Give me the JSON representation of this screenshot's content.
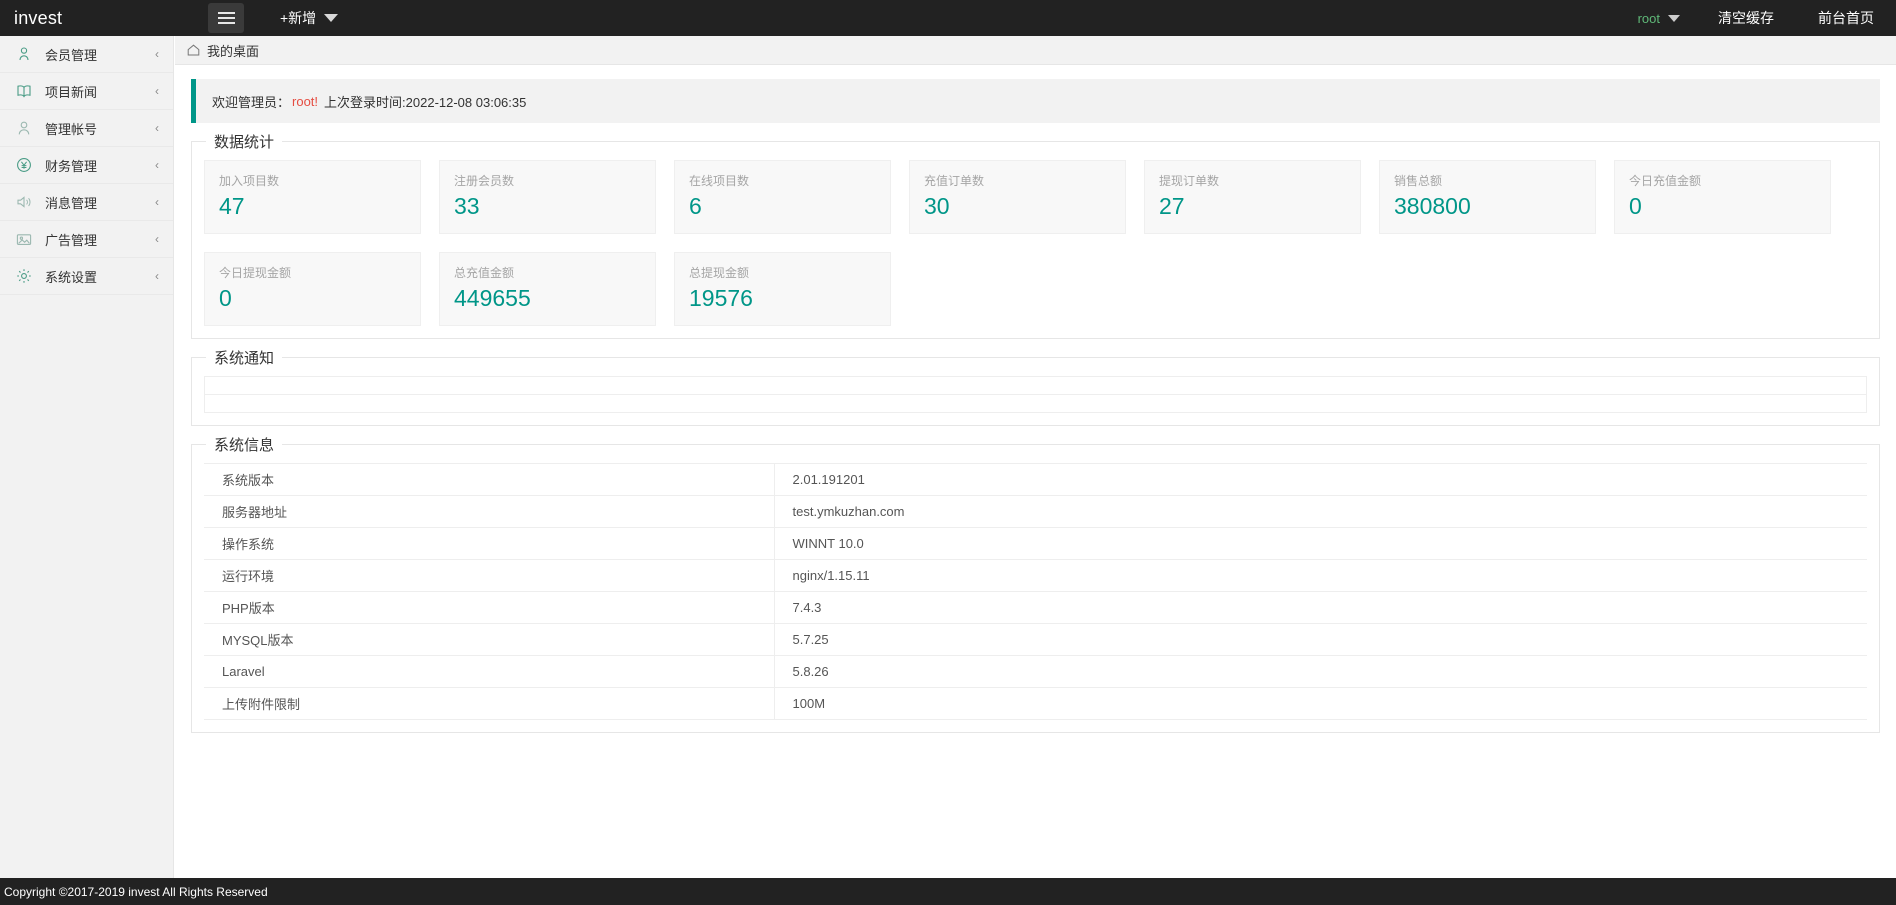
{
  "header": {
    "brand": "invest",
    "menu_toggle_icon": "hamburger-icon",
    "add_label": "+新增",
    "add_caret_icon": "chevron-down-icon",
    "user_name": "root",
    "user_caret_icon": "chevron-down-icon",
    "clear_cache_label": "清空缓存",
    "front_home_label": "前台首页",
    "accent_color": "#5fb878",
    "background_color": "#222222"
  },
  "sidebar": {
    "items": [
      {
        "label": "会员管理",
        "icon": "user-icon",
        "arrow_icon": "chevron-left-icon"
      },
      {
        "label": "项目新闻",
        "icon": "book-icon",
        "arrow_icon": "chevron-left-icon"
      },
      {
        "label": "管理帐号",
        "icon": "user-circle-icon",
        "arrow_icon": "chevron-left-icon"
      },
      {
        "label": "财务管理",
        "icon": "yen-circle-icon",
        "arrow_icon": "chevron-left-icon"
      },
      {
        "label": "消息管理",
        "icon": "speaker-icon",
        "arrow_icon": "chevron-left-icon"
      },
      {
        "label": "广告管理",
        "icon": "image-icon",
        "arrow_icon": "chevron-left-icon"
      },
      {
        "label": "系统设置",
        "icon": "gear-icon",
        "arrow_icon": "chevron-left-icon"
      }
    ]
  },
  "breadcrumb": {
    "home_icon": "home-icon",
    "current": "我的桌面"
  },
  "welcome": {
    "prefix": "欢迎管理员：",
    "user": "root!",
    "suffix": "上次登录时间:2022-12-08 03:06:35",
    "accent_color": "#009688",
    "user_color": "#e54d42"
  },
  "stats": {
    "title": "数据统计",
    "value_color": "#009688",
    "cards": [
      {
        "label": "加入项目数",
        "value": "47"
      },
      {
        "label": "注册会员数",
        "value": "33"
      },
      {
        "label": "在线项目数",
        "value": "6"
      },
      {
        "label": "充值订单数",
        "value": "30"
      },
      {
        "label": "提现订单数",
        "value": "27"
      },
      {
        "label": "销售总额",
        "value": "380800"
      },
      {
        "label": "今日充值金额",
        "value": "0"
      },
      {
        "label": "今日提现金额",
        "value": "0"
      },
      {
        "label": "总充值金额",
        "value": "449655"
      },
      {
        "label": "总提现金额",
        "value": "19576"
      }
    ]
  },
  "notice": {
    "title": "系统通知",
    "rows": [
      "",
      ""
    ]
  },
  "sysinfo": {
    "title": "系统信息",
    "rows": [
      {
        "key": "系统版本",
        "value": "2.01.191201"
      },
      {
        "key": "服务器地址",
        "value": "test.ymkuzhan.com"
      },
      {
        "key": "操作系统",
        "value": "WINNT 10.0"
      },
      {
        "key": "运行环境",
        "value": "nginx/1.15.11"
      },
      {
        "key": "PHP版本",
        "value": "7.4.3"
      },
      {
        "key": "MYSQL版本",
        "value": "5.7.25"
      },
      {
        "key": "Laravel",
        "value": "5.8.26"
      },
      {
        "key": "上传附件限制",
        "value": "100M"
      }
    ]
  },
  "footer": {
    "text": "Copyright ©2017-2019 invest All Rights Reserved"
  }
}
